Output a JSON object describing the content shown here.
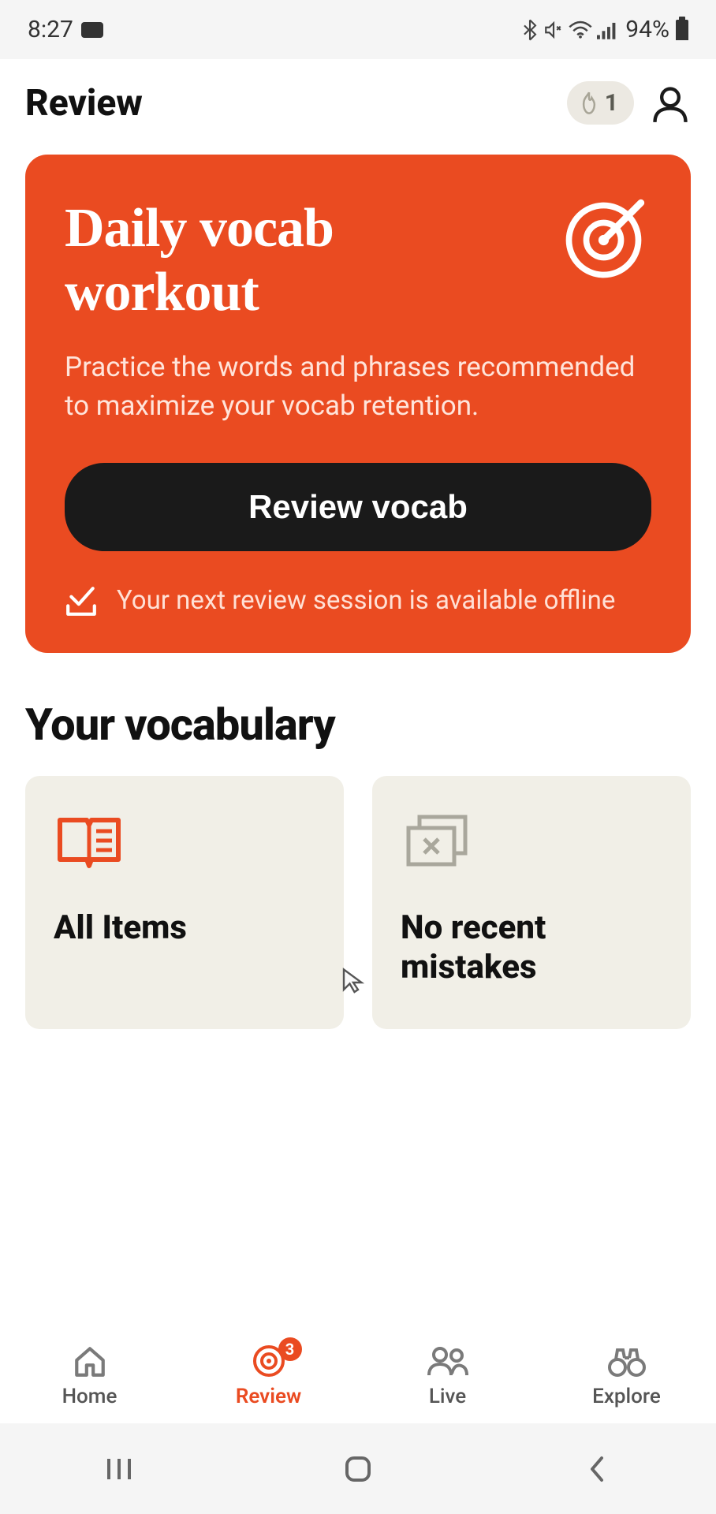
{
  "status": {
    "time": "8:27",
    "battery_pct": "94%"
  },
  "header": {
    "title": "Review",
    "streak_count": "1"
  },
  "workout_card": {
    "title_line1": "Daily vocab",
    "title_line2": "workout",
    "description": "Practice the words and phrases recommended to maximize your vocab retention.",
    "button_label": "Review vocab",
    "offline_text": "Your next review session is available offline"
  },
  "section_heading": "Your vocabulary",
  "vocab_cards": {
    "all_items_label": "All Items",
    "mistakes_label": "No recent mistakes"
  },
  "nav": {
    "home": "Home",
    "review": "Review",
    "review_badge": "3",
    "live": "Live",
    "explore": "Explore"
  }
}
